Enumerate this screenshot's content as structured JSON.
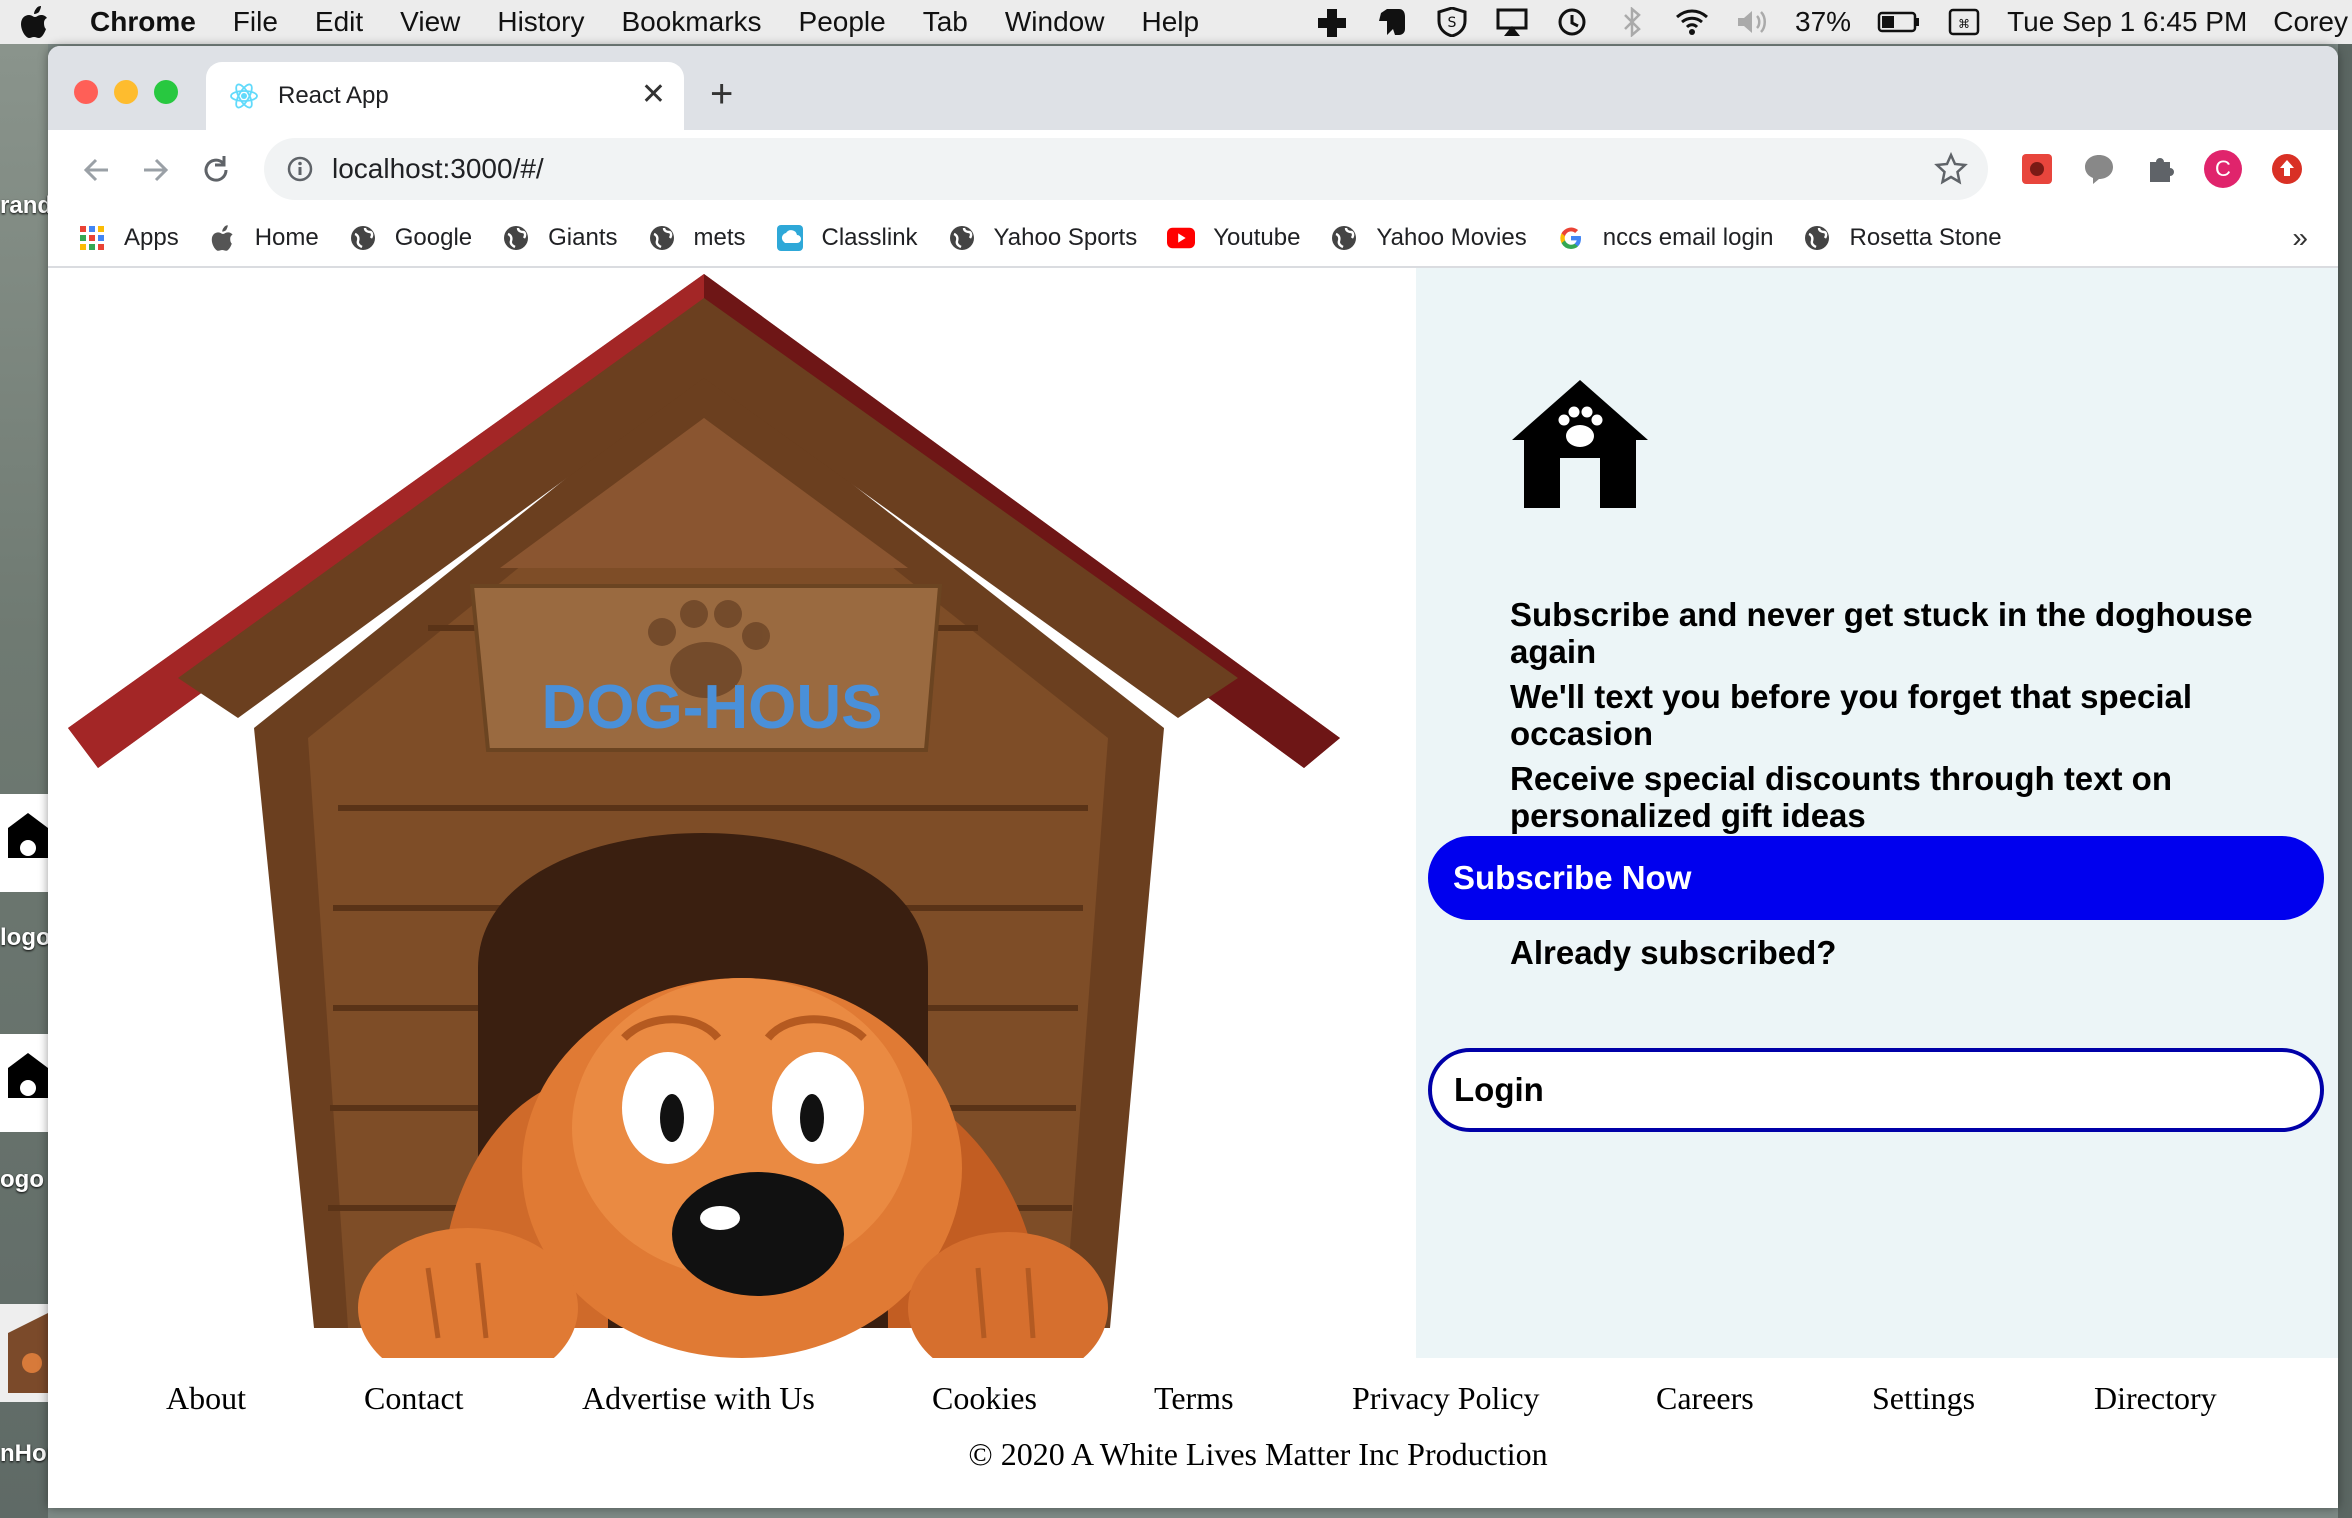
{
  "menubar": {
    "app": "Chrome",
    "items": [
      "File",
      "Edit",
      "View",
      "History",
      "Bookmarks",
      "People",
      "Tab",
      "Window",
      "Help"
    ],
    "battery": "37%",
    "datetime": "Tue Sep 1  6:45 PM",
    "user": "Corey"
  },
  "desktop": {
    "labels": [
      "rand",
      "logo",
      "ogo",
      "nHou"
    ]
  },
  "browser": {
    "tab_title": "React App",
    "url": "localhost:3000/#/",
    "profile_initial": "C",
    "bookmarks": [
      {
        "label": "Apps",
        "icon": "apps-grid-icon"
      },
      {
        "label": "Home",
        "icon": "apple-icon"
      },
      {
        "label": "Google",
        "icon": "globe-icon"
      },
      {
        "label": "Giants",
        "icon": "globe-icon"
      },
      {
        "label": "mets",
        "icon": "globe-icon"
      },
      {
        "label": "Classlink",
        "icon": "classlink-icon"
      },
      {
        "label": "Yahoo Sports",
        "icon": "globe-icon"
      },
      {
        "label": "Youtube",
        "icon": "youtube-icon"
      },
      {
        "label": "Yahoo Movies",
        "icon": "globe-icon"
      },
      {
        "label": "nccs email login",
        "icon": "google-icon"
      },
      {
        "label": "Rosetta Stone",
        "icon": "globe-icon"
      }
    ],
    "bookmarks_more": "»"
  },
  "hero": {
    "sign_text": "DOG-HOUS"
  },
  "panel": {
    "line1": "Subscribe and never get stuck in the doghouse again",
    "line2": "We'll text you before you forget that special occasion",
    "line3": "Receive special discounts through text on personalized gift ideas",
    "subscribe_label": "Subscribe Now",
    "already_label": "Already subscribed?",
    "login_label": "Login"
  },
  "footer": {
    "links": [
      "About",
      "Contact",
      "Advertise with Us",
      "Cookies",
      "Terms",
      "Privacy Policy",
      "Careers",
      "Settings",
      "Directory"
    ],
    "copyright": "© 2020 A White Lives Matter Inc Production"
  },
  "colors": {
    "subscribe_bg": "#0000ee",
    "login_border": "#0000a8",
    "panel_bg": "#ecf5f7",
    "sign_text": "#4a90d9"
  }
}
